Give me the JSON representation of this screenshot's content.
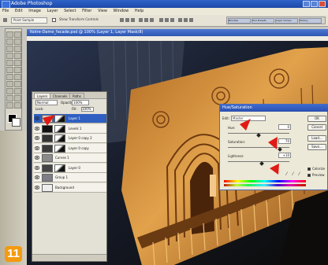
{
  "app": {
    "title": "Adobe Photoshop",
    "menu": [
      "File",
      "Edit",
      "Image",
      "Layer",
      "Select",
      "Filter",
      "View",
      "Window",
      "Help"
    ]
  },
  "options_bar": {
    "sample_size": "Point Sample",
    "show_handles": "Show Transform Controls",
    "palette_tabs": [
      "Brushes",
      "Tool Presets",
      "Layer Comps",
      "History"
    ]
  },
  "document": {
    "title": "Notre-Dame_facade.psd @ 100% (Layer 1, Layer Mask/8)"
  },
  "layers_panel": {
    "tabs": [
      "Layers",
      "Channels",
      "Paths"
    ],
    "blend_mode": "Normal",
    "opacity_label": "Opacity:",
    "opacity": "100%",
    "lock_label": "Lock:",
    "fill_label": "Fill:",
    "fill": "100%",
    "layers": [
      {
        "name": "Layer 1",
        "selected": true,
        "mask": true,
        "thumb": "#cfcfcf"
      },
      {
        "name": "Levels 1",
        "selected": false,
        "mask": true,
        "thumb": "#111111"
      },
      {
        "name": "Layer 0 copy 2",
        "selected": false,
        "mask": true,
        "thumb": "#333333"
      },
      {
        "name": "Layer 0 copy",
        "selected": false,
        "mask": true,
        "thumb": "#3a3a3a"
      },
      {
        "name": "Curves 1",
        "selected": false,
        "mask": false,
        "thumb": "#8a8a8a"
      },
      {
        "name": "Layer 0",
        "selected": false,
        "mask": true,
        "thumb": "#444444"
      },
      {
        "name": "Group 1",
        "selected": false,
        "mask": false,
        "thumb": "#7e7e88"
      },
      {
        "name": "Background",
        "selected": false,
        "mask": false,
        "thumb": "#eeeeee"
      }
    ]
  },
  "hue_saturation": {
    "title": "Hue/Saturation",
    "edit_label": "Edit:",
    "edit_value": "Master",
    "hue_label": "Hue:",
    "hue_value": "0",
    "hue_position": 0.5,
    "saturation_label": "Saturation:",
    "saturation_value": "70",
    "saturation_position": 0.85,
    "lightness_label": "Lightness:",
    "lightness_value": "+10",
    "lightness_position": 0.55,
    "buttons": [
      "OK",
      "Cancel",
      "Load...",
      "Save..."
    ],
    "colorize_label": "Colorize",
    "colorize_checked": true,
    "preview_label": "Preview",
    "preview_checked": true
  },
  "step_badge": "11",
  "colors": {
    "badge": "#f39a10",
    "arrow": "#e01a14",
    "highlight": "#2f5fc0",
    "stone": "#d99a44"
  }
}
